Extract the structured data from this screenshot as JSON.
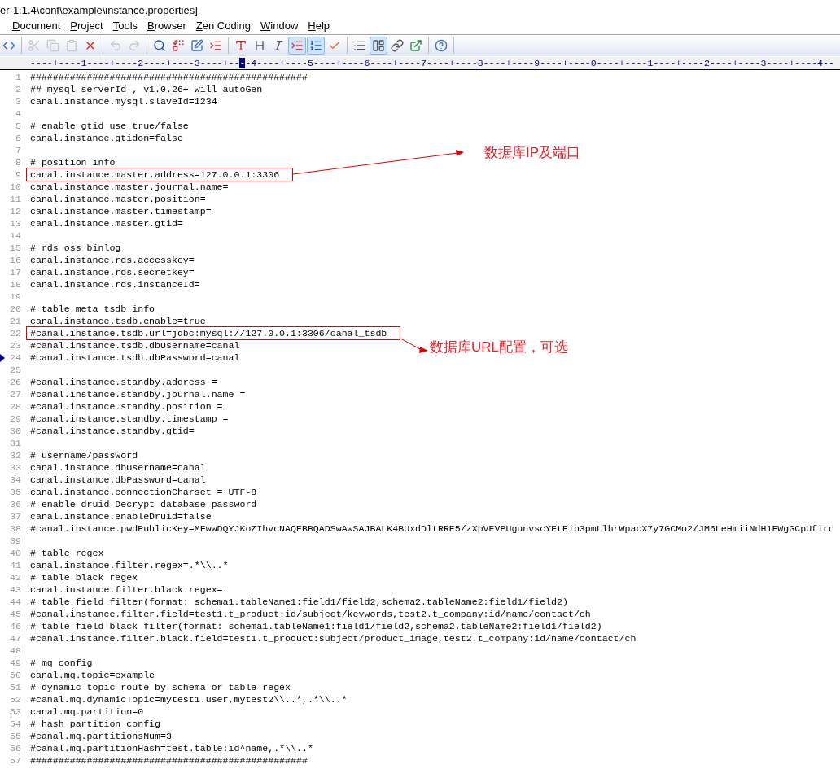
{
  "window": {
    "title": "er-1.1.4\\conf\\example\\instance.properties]"
  },
  "menu": [
    "Document",
    "Project",
    "Tools",
    "Browser",
    "Zen Coding",
    "Window",
    "Help"
  ],
  "toolbar": [
    {
      "kind": "button",
      "disabled": false,
      "pressed": false
    },
    {
      "kind": "separator"
    },
    {
      "kind": "button",
      "disabled": true,
      "pressed": false
    },
    {
      "kind": "button",
      "disabled": true,
      "pressed": false
    },
    {
      "kind": "button",
      "disabled": true,
      "pressed": false
    },
    {
      "kind": "button",
      "disabled": false,
      "pressed": false
    },
    {
      "kind": "separator"
    },
    {
      "kind": "button",
      "disabled": true,
      "pressed": false
    },
    {
      "kind": "button",
      "disabled": true,
      "pressed": false
    },
    {
      "kind": "separator"
    },
    {
      "kind": "button",
      "disabled": false,
      "pressed": false
    },
    {
      "kind": "button",
      "disabled": false,
      "pressed": false
    },
    {
      "kind": "button",
      "disabled": false,
      "pressed": false
    },
    {
      "kind": "button",
      "disabled": false,
      "pressed": false
    },
    {
      "kind": "separator"
    },
    {
      "kind": "button",
      "disabled": false,
      "pressed": false
    },
    {
      "kind": "button",
      "disabled": false,
      "pressed": false
    },
    {
      "kind": "button",
      "disabled": false,
      "pressed": false
    },
    {
      "kind": "button",
      "disabled": false,
      "pressed": true
    },
    {
      "kind": "button",
      "disabled": false,
      "pressed": true
    },
    {
      "kind": "button",
      "disabled": false,
      "pressed": false
    },
    {
      "kind": "separator"
    },
    {
      "kind": "button",
      "disabled": false,
      "pressed": false
    },
    {
      "kind": "button",
      "disabled": false,
      "pressed": true
    },
    {
      "kind": "button",
      "disabled": false,
      "pressed": false
    },
    {
      "kind": "button",
      "disabled": false,
      "pressed": false
    },
    {
      "kind": "separator"
    },
    {
      "kind": "button",
      "disabled": false,
      "pressed": false
    },
    {
      "kind": "separator"
    }
  ],
  "ruler": {
    "before": "----+----1----+----2----+----3----+--",
    "cursor": "-",
    "after": "-4----+----5----+----6----+----7----+----8----+----9----+----0----+----1----+----2----+----3----+----4--"
  },
  "lines": [
    {
      "number": "1",
      "text": "#################################################",
      "bookmark": false,
      "boxed": false
    },
    {
      "number": "2",
      "text": "## mysql serverId , v1.0.26+ will autoGen",
      "bookmark": false,
      "boxed": false
    },
    {
      "number": "3",
      "text": "canal.instance.mysql.slaveId=1234",
      "bookmark": false,
      "boxed": false
    },
    {
      "number": "4",
      "bookmark": false
    },
    {
      "number": "5",
      "text": "# enable gtid use true/false",
      "bookmark": false,
      "boxed": false
    },
    {
      "number": "6",
      "text": "canal.instance.gtidon=false",
      "bookmark": false,
      "boxed": false
    },
    {
      "number": "7",
      "bookmark": false
    },
    {
      "number": "8",
      "text": "# position info",
      "bookmark": false,
      "boxed": false
    },
    {
      "number": "9",
      "text": "canal.instance.master.address=127.0.0.1:3306",
      "bookmark": false,
      "boxed": true
    },
    {
      "number": "10",
      "text": "canal.instance.master.journal.name=",
      "bookmark": false,
      "boxed": false
    },
    {
      "number": "11",
      "text": "canal.instance.master.position=",
      "bookmark": false,
      "boxed": false
    },
    {
      "number": "12",
      "text": "canal.instance.master.timestamp=",
      "bookmark": false,
      "boxed": false
    },
    {
      "number": "13",
      "text": "canal.instance.master.gtid=",
      "bookmark": false,
      "boxed": false
    },
    {
      "number": "14",
      "bookmark": false
    },
    {
      "number": "15",
      "text": "# rds oss binlog",
      "bookmark": false,
      "boxed": false
    },
    {
      "number": "16",
      "text": "canal.instance.rds.accesskey=",
      "bookmark": false,
      "boxed": false
    },
    {
      "number": "17",
      "text": "canal.instance.rds.secretkey=",
      "bookmark": false,
      "boxed": false
    },
    {
      "number": "18",
      "text": "canal.instance.rds.instanceId=",
      "bookmark": false,
      "boxed": false
    },
    {
      "number": "19",
      "bookmark": false
    },
    {
      "number": "20",
      "text": "# table meta tsdb info",
      "bookmark": false,
      "boxed": false
    },
    {
      "number": "21",
      "text": "canal.instance.tsdb.enable=true",
      "bookmark": false,
      "boxed": false
    },
    {
      "number": "22",
      "text": "#canal.instance.tsdb.url=jdbc:mysql://127.0.0.1:3306/canal_tsdb",
      "bookmark": false,
      "boxed": true
    },
    {
      "number": "23",
      "text": "#canal.instance.tsdb.dbUsername=canal",
      "bookmark": false,
      "boxed": false
    },
    {
      "number": "24",
      "text": "#canal.instance.tsdb.dbPassword=canal",
      "bookmark": true,
      "boxed": false
    },
    {
      "number": "25",
      "bookmark": false
    },
    {
      "number": "26",
      "text": "#canal.instance.standby.address =",
      "bookmark": false,
      "boxed": false
    },
    {
      "number": "27",
      "text": "#canal.instance.standby.journal.name =",
      "bookmark": false,
      "boxed": false
    },
    {
      "number": "28",
      "text": "#canal.instance.standby.position =",
      "bookmark": false,
      "boxed": false
    },
    {
      "number": "29",
      "text": "#canal.instance.standby.timestamp =",
      "bookmark": false,
      "boxed": false
    },
    {
      "number": "30",
      "text": "#canal.instance.standby.gtid=",
      "bookmark": false,
      "boxed": false
    },
    {
      "number": "31",
      "bookmark": false
    },
    {
      "number": "32",
      "text": "# username/password",
      "bookmark": false,
      "boxed": false
    },
    {
      "number": "33",
      "text": "canal.instance.dbUsername=canal",
      "bookmark": false,
      "boxed": false
    },
    {
      "number": "34",
      "text": "canal.instance.dbPassword=canal",
      "bookmark": false,
      "boxed": false
    },
    {
      "number": "35",
      "text": "canal.instance.connectionCharset = UTF-8",
      "bookmark": false,
      "boxed": false
    },
    {
      "number": "36",
      "text": "# enable druid Decrypt database password",
      "bookmark": false,
      "boxed": false
    },
    {
      "number": "37",
      "text": "canal.instance.enableDruid=false",
      "bookmark": false,
      "boxed": false
    },
    {
      "number": "38",
      "text": "#canal.instance.pwdPublicKey=MFwwDQYJKoZIhvcNAQEBBQADSwAwSAJBALK4BUxdDltRRE5/zXpVEVPUgunvscYFtEip3pmLlhrWpacX7y7GCMo2/JM6LeHmiiNdH1FWgGCpUfirc",
      "bookmark": false,
      "boxed": false
    },
    {
      "number": "39",
      "bookmark": false
    },
    {
      "number": "40",
      "text": "# table regex",
      "bookmark": false,
      "boxed": false
    },
    {
      "number": "41",
      "text": "canal.instance.filter.regex=.*\\\\..*",
      "bookmark": false,
      "boxed": false
    },
    {
      "number": "42",
      "text": "# table black regex",
      "bookmark": false,
      "boxed": false
    },
    {
      "number": "43",
      "text": "canal.instance.filter.black.regex=",
      "bookmark": false,
      "boxed": false
    },
    {
      "number": "44",
      "text": "# table field filter(format: schema1.tableName1:field1/field2,schema2.tableName2:field1/field2)",
      "bookmark": false,
      "boxed": false
    },
    {
      "number": "45",
      "text": "#canal.instance.filter.field=test1.t_product:id/subject/keywords,test2.t_company:id/name/contact/ch",
      "bookmark": false,
      "boxed": false
    },
    {
      "number": "46",
      "text": "# table field black filter(format: schema1.tableName1:field1/field2,schema2.tableName2:field1/field2)",
      "bookmark": false,
      "boxed": false
    },
    {
      "number": "47",
      "text": "#canal.instance.filter.black.field=test1.t_product:subject/product_image,test2.t_company:id/name/contact/ch",
      "bookmark": false,
      "boxed": false
    },
    {
      "number": "48",
      "bookmark": false
    },
    {
      "number": "49",
      "text": "# mq config",
      "bookmark": false,
      "boxed": false
    },
    {
      "number": "50",
      "text": "canal.mq.topic=example",
      "bookmark": false,
      "boxed": false
    },
    {
      "number": "51",
      "text": "# dynamic topic route by schema or table regex",
      "bookmark": false,
      "boxed": false
    },
    {
      "number": "52",
      "text": "#canal.mq.dynamicTopic=mytest1.user,mytest2\\\\..*,.*\\\\..*",
      "bookmark": false,
      "boxed": false
    },
    {
      "number": "53",
      "text": "canal.mq.partition=0",
      "bookmark": false,
      "boxed": false
    },
    {
      "number": "54",
      "text": "# hash partition config",
      "bookmark": false,
      "boxed": false
    },
    {
      "number": "55",
      "text": "#canal.mq.partitionsNum=3",
      "bookmark": false,
      "boxed": false
    },
    {
      "number": "56",
      "text": "#canal.mq.partitionHash=test.table:id^name,.*\\\\..*",
      "bookmark": false,
      "boxed": false
    },
    {
      "number": "57",
      "text": "#################################################",
      "bookmark": false,
      "boxed": false
    }
  ],
  "annotations": [
    {
      "label": "数据库IP及端口"
    },
    {
      "label": "数据库URL配置，可选"
    }
  ]
}
